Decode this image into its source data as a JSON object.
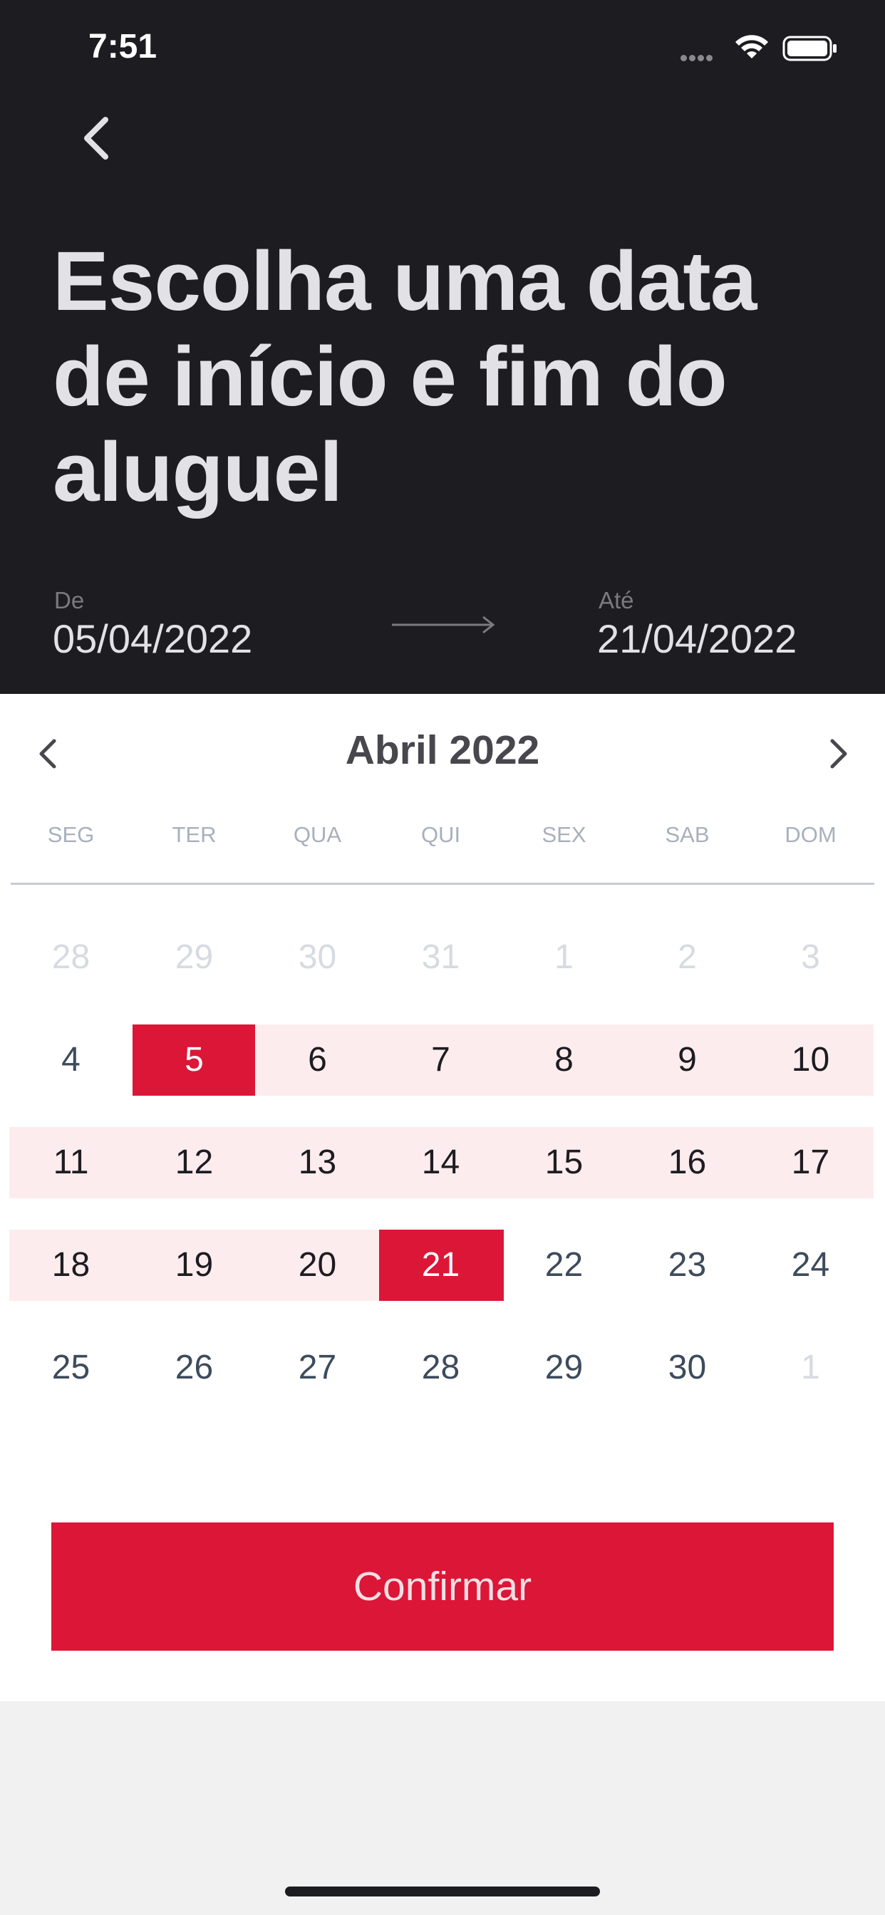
{
  "status_bar": {
    "time": "7:51"
  },
  "header": {
    "title": "Escolha uma data de início e fim do aluguel",
    "from_label": "De",
    "from_value": "05/04/2022",
    "to_label": "Até",
    "to_value": "21/04/2022"
  },
  "calendar": {
    "month_label": "Abril 2022",
    "weekdays": [
      "SEG",
      "TER",
      "QUA",
      "QUI",
      "SEX",
      "SAB",
      "DOM"
    ],
    "weeks": [
      [
        "28",
        "29",
        "30",
        "31",
        "1",
        "2",
        "3"
      ],
      [
        "4",
        "5",
        "6",
        "7",
        "8",
        "9",
        "10"
      ],
      [
        "11",
        "12",
        "13",
        "14",
        "15",
        "16",
        "17"
      ],
      [
        "18",
        "19",
        "20",
        "21",
        "22",
        "23",
        "24"
      ],
      [
        "25",
        "26",
        "27",
        "28",
        "29",
        "30",
        "1"
      ]
    ],
    "selected_start": "5",
    "selected_end": "21"
  },
  "confirm_label": "Confirmar",
  "colors": {
    "header_bg": "#1d1c21",
    "accent": "#dc1637",
    "range_bg": "#fdecee"
  },
  "icons": {
    "back": "chevron-left-icon",
    "arrow": "arrow-right-icon",
    "prev_month": "chevron-left-icon",
    "next_month": "chevron-right-icon"
  }
}
